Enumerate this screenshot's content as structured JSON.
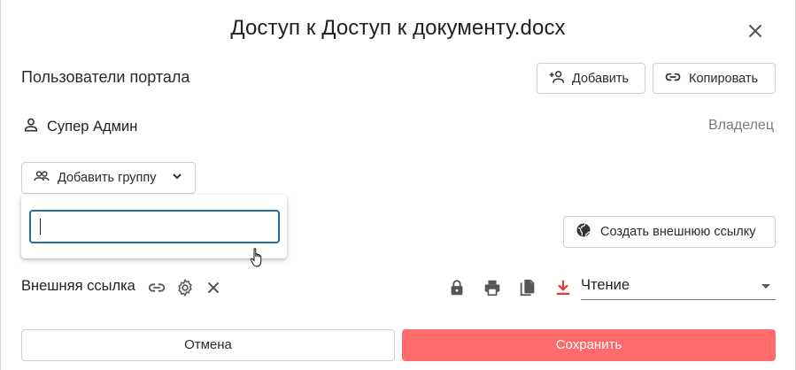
{
  "dialog": {
    "title": "Доступ к Доступ к документу.docx"
  },
  "portal_users": {
    "label": "Пользователи портала",
    "add_button": "Добавить",
    "copy_button": "Копировать"
  },
  "user": {
    "name": "Супер Админ",
    "role": "Владелец"
  },
  "group": {
    "add_group_button": "Добавить группу",
    "search_value": "",
    "search_placeholder": ""
  },
  "external": {
    "create_link_button": "Создать внешнюю ссылку",
    "link_label": "Внешняя ссылка",
    "permission": "Чтение"
  },
  "footer": {
    "cancel": "Отмена",
    "save": "Сохранить"
  },
  "colors": {
    "accent": "#ff6b6b",
    "focus": "#1d6fa5",
    "download_icon": "#e53935"
  }
}
